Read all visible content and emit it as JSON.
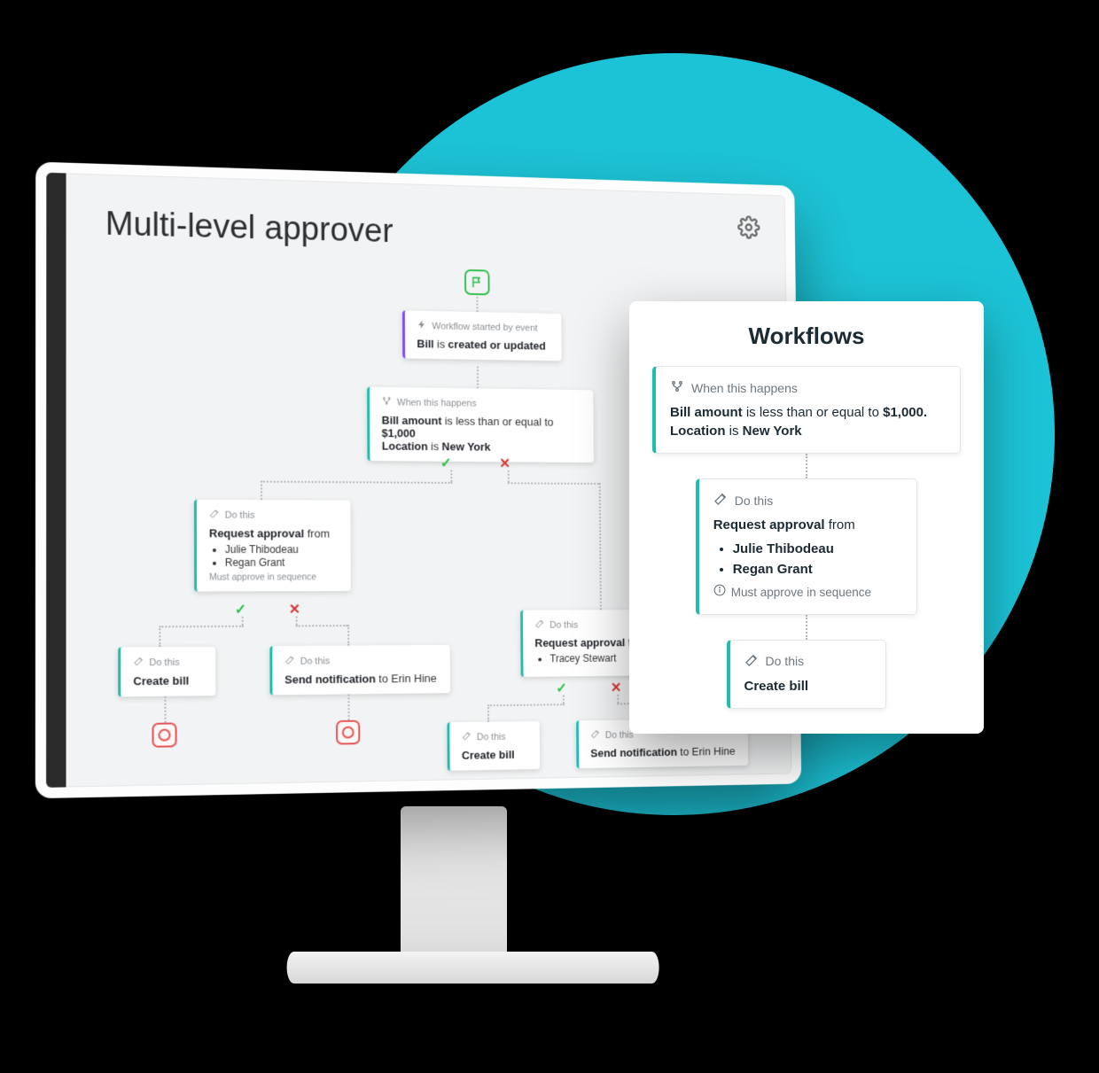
{
  "page": {
    "title": "Multi-level approver"
  },
  "popout": {
    "title": "Workflows",
    "condition": {
      "header": "When this happens",
      "line1_field": "Bill amount",
      "line1_rest": " is less than or equal to ",
      "line1_value": "$1,000.",
      "line2_field": " Location",
      "line2_rest": " is ",
      "line2_value": "New York"
    },
    "action1": {
      "header": "Do this",
      "title": "Request approval",
      "rest": " from",
      "approvers": [
        "Julie Thibodeau",
        "Regan Grant"
      ],
      "seq_note": "Must approve in sequence"
    },
    "action2": {
      "header": "Do this",
      "title": "Create bill"
    }
  },
  "flow": {
    "start": {
      "header": "Workflow started by event",
      "subject": "Bill",
      "rest": " is ",
      "value": "created or updated"
    },
    "cond": {
      "header": "When this happens",
      "l1_field": "Bill amount",
      "l1_rest": " is less than or equal to ",
      "l1_value": "$1,000",
      "l2_field": "Location",
      "l2_rest": " is ",
      "l2_value": "New York"
    },
    "left_request": {
      "header": "Do this",
      "title": "Request approval",
      "rest": " from",
      "approvers": [
        "Julie Thibodeau",
        "Regan Grant"
      ],
      "seq_note": "Must approve in sequence"
    },
    "right_request": {
      "header": "Do this",
      "title": "Request approval",
      "rest": " from",
      "approvers": [
        "Tracey Stewart"
      ]
    },
    "create_bill": {
      "header": "Do this",
      "title": "Create bill"
    },
    "notify": {
      "header": "Do this",
      "title": "Send notification",
      "rest": " to Erin Hine"
    }
  }
}
